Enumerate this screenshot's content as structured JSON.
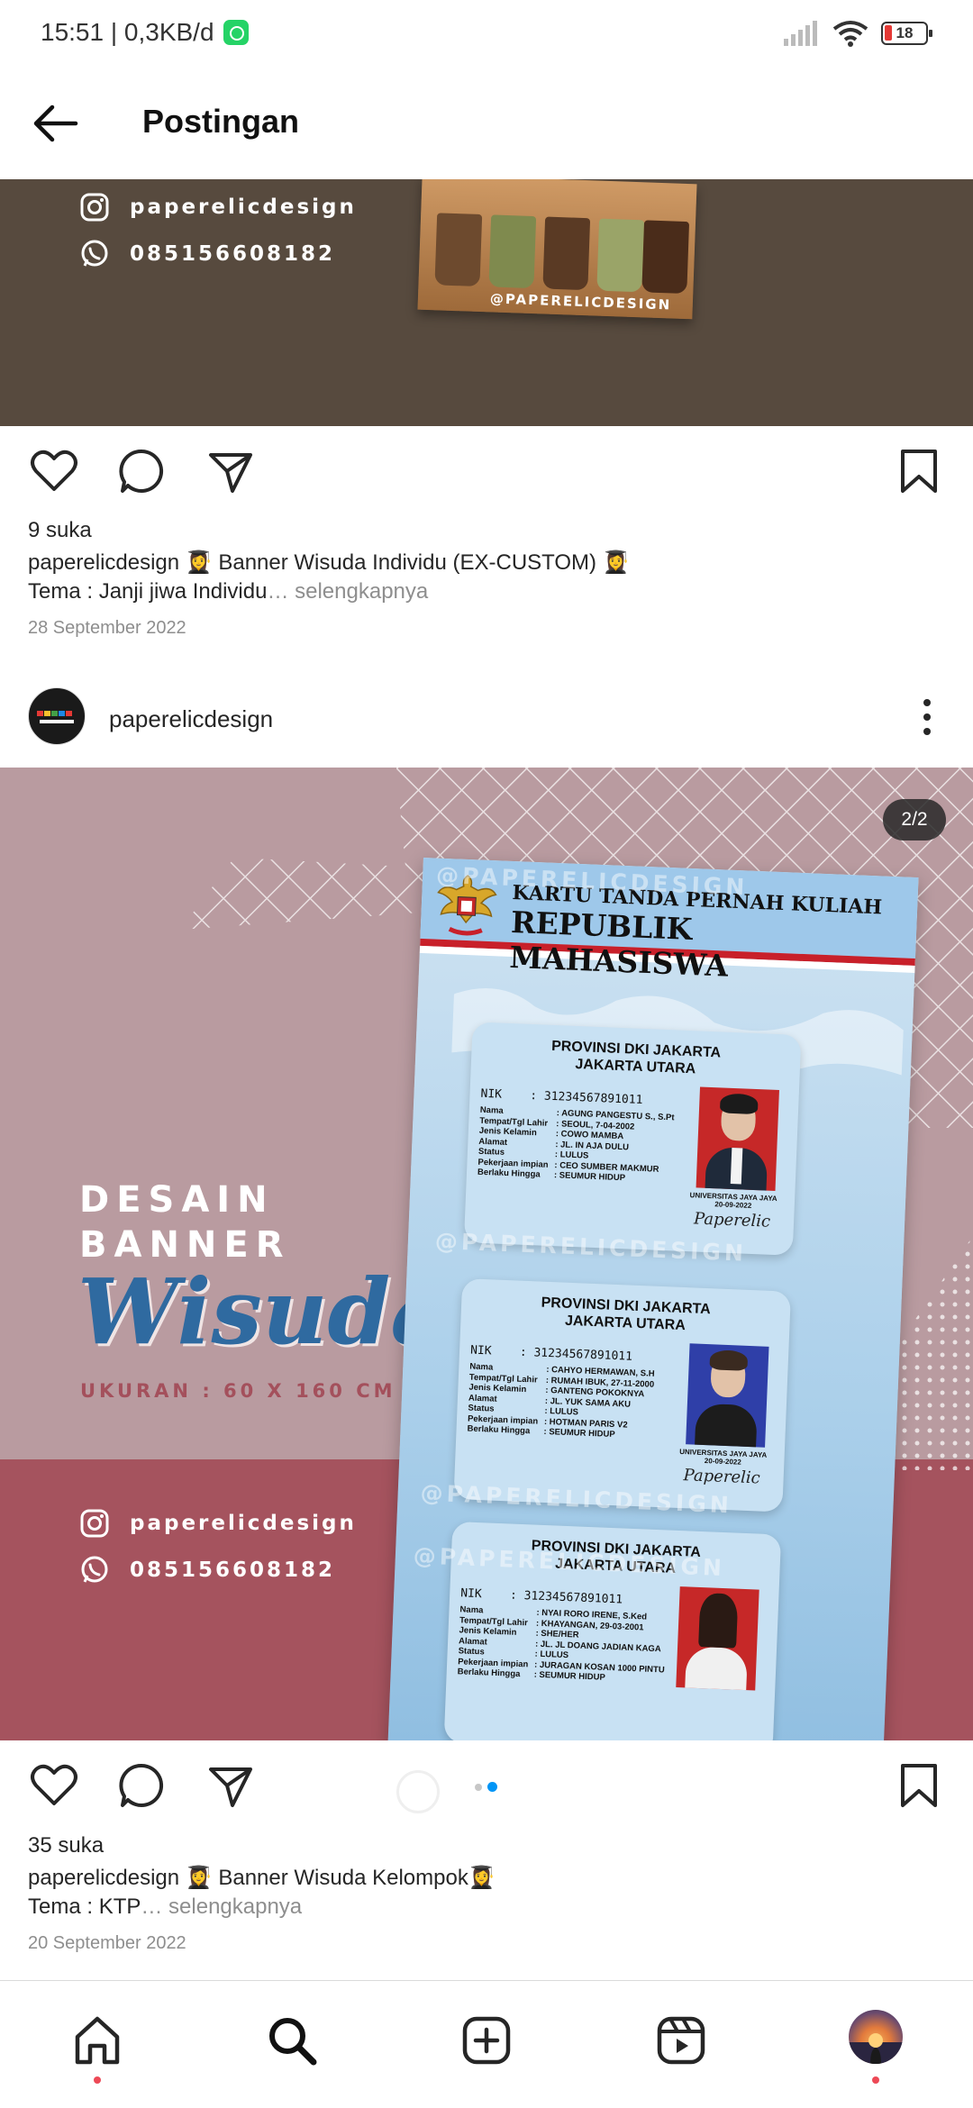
{
  "status_bar": {
    "time_data": "15:51 | 0,3KB/d",
    "battery": "18"
  },
  "header": {
    "title": "Postingan"
  },
  "post1": {
    "instagram_handle": "paperelicdesign",
    "phone": "08515660818​2",
    "image_watermark": "@PAPERELICDESIGN",
    "likes": "9 suka",
    "caption_user": "paperelicdesign",
    "caption_line1": " 👩‍🎓 Banner Wisuda Individu (EX-CUSTOM) 👩‍🎓",
    "caption_line2": "Tema : Janji jiwa Individu",
    "more": "… selengkapnya",
    "date": "28 September 2022"
  },
  "post2": {
    "username": "paperelicdesign",
    "counter": "2/2",
    "image": {
      "title_line1": "DESAIN",
      "title_line2": "BANNER",
      "title_script": "Wisuda",
      "size_text": "UKURAN : 60 X 160 CM",
      "instagram_handle": "paperelicdesign",
      "phone": "08515660818​2",
      "watermark": "@PAPERELICDESIGN",
      "banner_title1": "KARTU TANDA PERNAH KULIAH",
      "banner_title2": "REPUBLIK MAHASISWA",
      "cards": [
        {
          "province": "PROVINSI DKI JAKARTA",
          "city": "JAKARTA UTARA",
          "nik_label": "NIK",
          "nik": ": 3123456789101​1",
          "fields": [
            {
              "k": "Nama",
              "v": ": AGUNG PANGESTU S., S.Pt"
            },
            {
              "k": "Tempat/Tgl Lahir",
              "v": ": SEOUL, 7-04-2002"
            },
            {
              "k": "Jenis Kelamin",
              "v": ": COWO MAMBA"
            },
            {
              "k": "Alamat",
              "v": ": JL. IN AJA DULU"
            },
            {
              "k": "Status",
              "v": ": LULUS"
            },
            {
              "k": "Pekerjaan impian",
              "v": ": CEO SUMBER MAKMUR"
            },
            {
              "k": "Berlaku Hingga",
              "v": ": SEUMUR HIDUP"
            }
          ],
          "univ": "UNIVERSITAS JAYA JAYA",
          "univ_date": "20-09-2022",
          "sign": "Paperelic",
          "photo_bg": "#c62828"
        },
        {
          "province": "PROVINSI DKI JAKARTA",
          "city": "JAKARTA UTARA",
          "nik_label": "NIK",
          "nik": ": 3123456789101​1",
          "fields": [
            {
              "k": "Nama",
              "v": ": CAHYO HERMAWAN, S.H"
            },
            {
              "k": "Tempat/Tgl Lahir",
              "v": ": RUMAH IBUK, 27-11-2000"
            },
            {
              "k": "Jenis Kelamin",
              "v": ": GANTENG POKOKNYA"
            },
            {
              "k": "Alamat",
              "v": ": JL. YUK SAMA AKU"
            },
            {
              "k": "Status",
              "v": ": LULUS"
            },
            {
              "k": "Pekerjaan impian",
              "v": ": HOTMAN PARIS V2"
            },
            {
              "k": "Berlaku Hingga",
              "v": ": SEUMUR HIDUP"
            }
          ],
          "univ": "UNIVERSITAS JAYA JAYA",
          "univ_date": "20-09-2022",
          "sign": "Paperelic",
          "photo_bg": "#2f3fa8"
        },
        {
          "province": "PROVINSI DKI JAKARTA",
          "city": "JAKARTA UTARA",
          "nik_label": "NIK",
          "nik": ": 3123456789101​1",
          "fields": [
            {
              "k": "Nama",
              "v": ": NYAI RORO IRENE, S.Ked"
            },
            {
              "k": "Tempat/Tgl Lahir",
              "v": ": KHAYANGAN, 29-03-2001"
            },
            {
              "k": "Jenis Kelamin",
              "v": ": SHE/HER"
            },
            {
              "k": "Alamat",
              "v": ": JL. JL DOANG JADIAN KAGA"
            },
            {
              "k": "Status",
              "v": ": LULUS"
            },
            {
              "k": "Pekerjaan impian",
              "v": ": JURAGAN KOSAN 1000 PINTU"
            },
            {
              "k": "Berlaku Hingga",
              "v": ": SEUMUR HIDUP"
            }
          ],
          "univ": "",
          "univ_date": "",
          "sign": "",
          "photo_bg": "#c62828"
        }
      ]
    },
    "likes": "35 suka",
    "caption_user": "paperelicdesign",
    "caption_line1": " 👩‍🎓 Banner Wisuda Kelompok👩‍🎓",
    "caption_line2": "Tema : KTP",
    "more": "… selengkapnya",
    "date": "20 September 2022"
  },
  "bottom_nav": {
    "items": [
      "home-icon",
      "search-icon",
      "create-icon",
      "reels-icon",
      "profile-avatar"
    ]
  },
  "colors": {
    "notification_dot": "#ed4956",
    "carousel_active_dot": "#0095f6",
    "post1_bg": "#574a3e",
    "post2_bg_top": "#b99ba0",
    "post2_bg_bottom": "#a5535e"
  }
}
